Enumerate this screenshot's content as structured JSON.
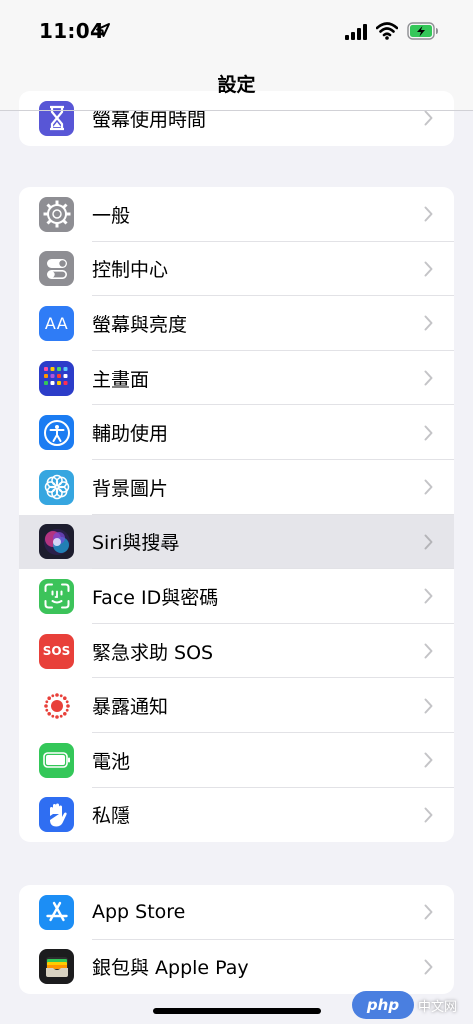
{
  "status_bar": {
    "time": "11:04"
  },
  "nav": {
    "title": "設定"
  },
  "groups": [
    {
      "rows": [
        {
          "label": "螢幕使用時間",
          "icon": "hourglass-icon",
          "color": "#5856d6"
        }
      ]
    },
    {
      "rows": [
        {
          "label": "一般",
          "icon": "gear-icon",
          "color": "#8e8e93"
        },
        {
          "label": "控制中心",
          "icon": "toggles-icon",
          "color": "#8e8e93"
        },
        {
          "label": "螢幕與亮度",
          "icon": "text-size-icon",
          "color": "#2f7cf6",
          "icon_text": "AA"
        },
        {
          "label": "主畫面",
          "icon": "app-grid-icon",
          "color": "#2c3dc9"
        },
        {
          "label": "輔助使用",
          "icon": "accessibility-icon",
          "color": "#1b7cf2"
        },
        {
          "label": "背景圖片",
          "icon": "flower-icon",
          "color": "#36a6e0"
        },
        {
          "label": "Siri與搜尋",
          "icon": "siri-icon",
          "color": "#1d1d2e",
          "highlighted": true
        },
        {
          "label": "Face ID與密碼",
          "icon": "face-id-icon",
          "color": "#3cc35a"
        },
        {
          "label": "緊急求助 SOS",
          "icon": "sos-icon",
          "color": "#e8403a",
          "icon_text": "SOS"
        },
        {
          "label": "暴露通知",
          "icon": "exposure-icon",
          "color": "#ffffff"
        },
        {
          "label": "電池",
          "icon": "battery-icon",
          "color": "#34c759"
        },
        {
          "label": "私隱",
          "icon": "hand-icon",
          "color": "#2f6ef2"
        }
      ]
    },
    {
      "rows": [
        {
          "label": "App Store",
          "icon": "app-store-icon",
          "color": "#1c8ef5"
        },
        {
          "label": "銀包與 Apple Pay",
          "icon": "wallet-icon",
          "color": "#1c1c1e"
        }
      ]
    }
  ],
  "watermark": {
    "logo": "php",
    "text": "中文网"
  }
}
